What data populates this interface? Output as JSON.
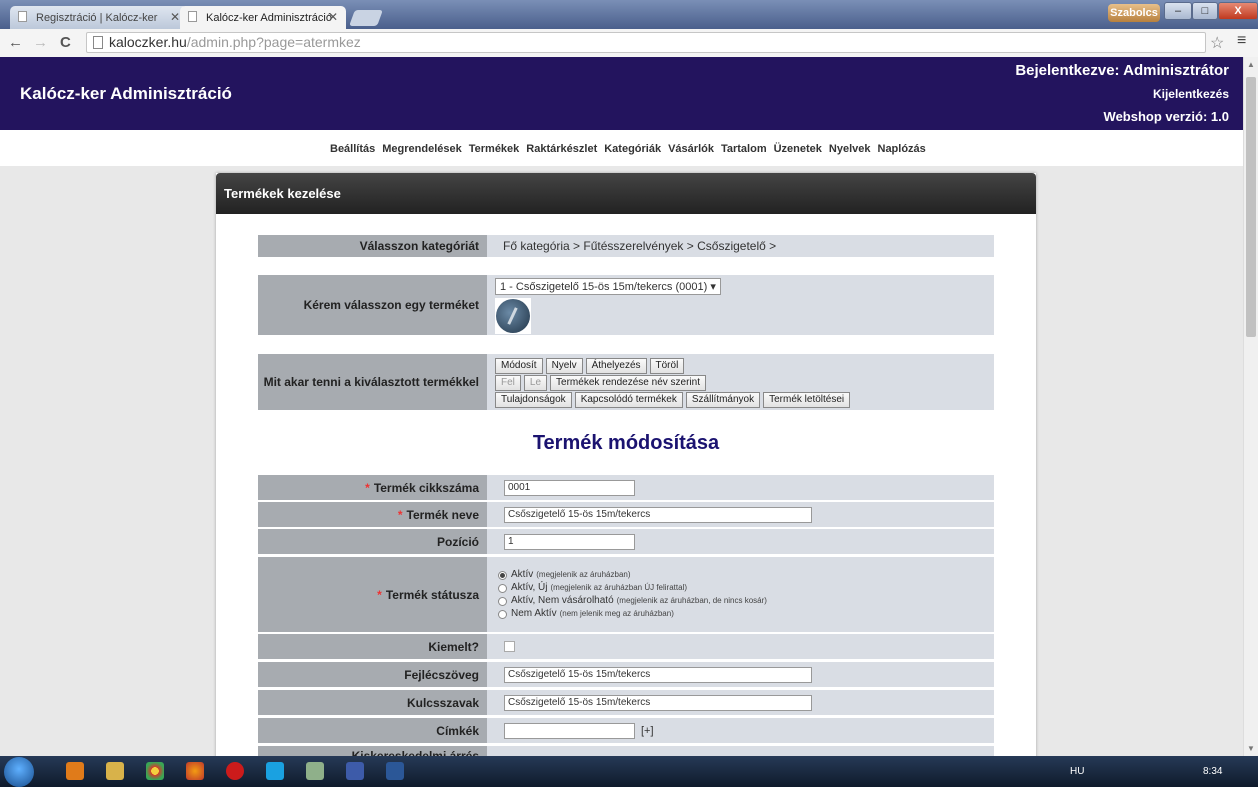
{
  "browser": {
    "tabs": [
      {
        "title": "Regisztráció | Kalócz-ker",
        "active": false
      },
      {
        "title": "Kalócz-ker Adminisztráció",
        "active": true
      }
    ],
    "user_badge": "Szabolcs",
    "url_host": "kaloczker.hu",
    "url_path": "/admin.php?page=atermkez"
  },
  "header": {
    "site_title": "Kalócz-ker Adminisztráció",
    "logged_in": "Bejelentkezve: Adminisztrátor",
    "logout": "Kijelentkezés",
    "version": "Webshop verzió: 1.0"
  },
  "nav": [
    "Beállítás",
    "Megrendelések",
    "Termékek",
    "Raktárkészlet",
    "Kategóriák",
    "Vásárlók",
    "Tartalom",
    "Üzenetek",
    "Nyelvek",
    "Naplózás"
  ],
  "panel": {
    "title": "Termékek kezelése",
    "category_label": "Válasszon kategóriát",
    "category_path": "Fő kategória > Fűtésszerelvények > Csőszigetelő >",
    "product_label": "Kérem válasszon egy terméket",
    "product_selected": "1 - Csőszigetelő 15-ös 15m/tekercs (0001)",
    "action_label": "Mit akar tenni a kiválasztott termékkel",
    "buttons_row1": [
      "Módosít",
      "Nyelv",
      "Áthelyezés",
      "Töröl"
    ],
    "buttons_row2": [
      "Fel",
      "Le",
      "Termékek rendezése név szerint"
    ],
    "buttons_row3": [
      "Tulajdonságok",
      "Kapcsolódó termékek",
      "Szállítmányok",
      "Termék letöltései"
    ],
    "edit_title": "Termék módosítása",
    "fields": {
      "sku_label": "Termék cikkszáma",
      "sku_value": "0001",
      "name_label": "Termék neve",
      "name_value": "Csőszigetelő 15-ös 15m/tekercs",
      "position_label": "Pozíció",
      "position_value": "1",
      "status_label": "Termék státusza",
      "status_options": [
        {
          "label": "Aktív",
          "note": "(megjelenik az áruházban)",
          "selected": true
        },
        {
          "label": "Aktív, Új",
          "note": "(megjelenik az áruházban ÚJ felirattal)",
          "selected": false
        },
        {
          "label": "Aktív, Nem vásárolható",
          "note": "(megjelenik az áruházban, de nincs kosár)",
          "selected": false
        },
        {
          "label": "Nem Aktív",
          "note": "(nem jelenik meg az áruházban)",
          "selected": false
        }
      ],
      "featured_label": "Kiemelt?",
      "header_text_label": "Fejlécszöveg",
      "header_text_value": "Csőszigetelő 15-ös 15m/tekercs",
      "keywords_label": "Kulcsszavak",
      "keywords_value": "Csőszigetelő 15-ös 15m/tekercs",
      "tags_label": "Címkék",
      "tags_add": "[+]",
      "retail_margin_label": "Kiskereskedelmi árrés"
    }
  },
  "taskbar": {
    "lang": "HU",
    "time": "8:34"
  }
}
